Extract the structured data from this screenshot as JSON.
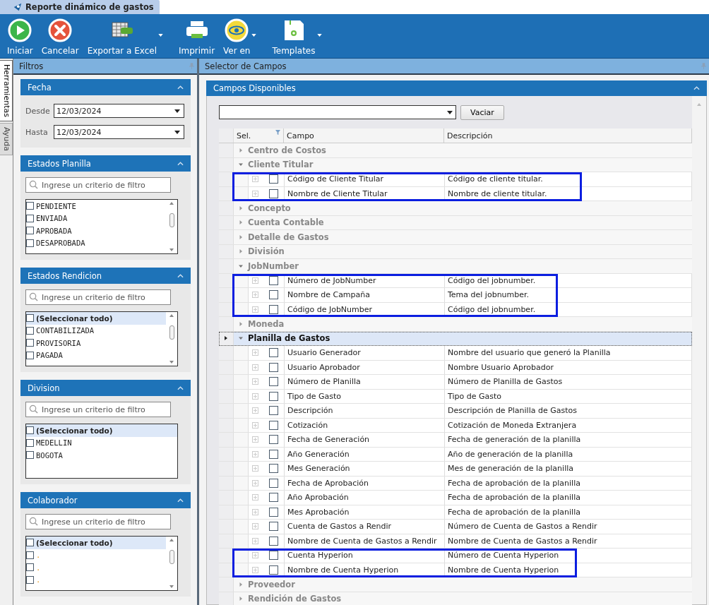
{
  "document_tab": {
    "title": "Reporte dinámico de gastos",
    "selected": true
  },
  "toolbar": [
    {
      "label": "Iniciar",
      "kind": "play",
      "dropdown": false
    },
    {
      "label": "Cancelar",
      "kind": "cancel",
      "dropdown": false
    },
    {
      "label": "Exportar a Excel",
      "kind": "excel",
      "dropdown": true
    },
    {
      "label": "Imprimir",
      "kind": "print",
      "dropdown": false
    },
    {
      "label": "Ver en",
      "kind": "view",
      "dropdown": true
    },
    {
      "label": "Templates",
      "kind": "save",
      "dropdown": true
    }
  ],
  "side_tabs": [
    {
      "label": "Herramientas",
      "selected": true
    },
    {
      "label": "Ayuda",
      "selected": false
    }
  ],
  "filters_panel": {
    "title": "Filtros",
    "sections": [
      {
        "kind": "dates",
        "title": "Fecha",
        "fields": [
          {
            "label": "Desde",
            "value": "12/03/2024"
          },
          {
            "label": "Hasta",
            "value": "12/03/2024"
          }
        ]
      },
      {
        "kind": "list",
        "title": "Estados Planilla",
        "search_placeholder": "Ingrese un criterio de filtro",
        "scrollable": true,
        "items": [
          {
            "label": "PENDIENTE",
            "checked": false,
            "selected": false
          },
          {
            "label": "ENVIADA",
            "checked": false,
            "selected": false
          },
          {
            "label": "APROBADA",
            "checked": false,
            "selected": false
          },
          {
            "label": "DESAPROBADA",
            "checked": false,
            "selected": false
          }
        ]
      },
      {
        "kind": "list",
        "title": "Estados Rendicion",
        "search_placeholder": "Ingrese un criterio de filtro",
        "scrollable": true,
        "items": [
          {
            "label": "(Seleccionar todo)",
            "checked": false,
            "selected": true
          },
          {
            "label": "CONTABILIZADA",
            "checked": false,
            "selected": false
          },
          {
            "label": "PROVISORIA",
            "checked": false,
            "selected": false
          },
          {
            "label": "PAGADA",
            "checked": false,
            "selected": false
          }
        ]
      },
      {
        "kind": "list",
        "title": "Division",
        "search_placeholder": "Ingrese un criterio de filtro",
        "scrollable": false,
        "items": [
          {
            "label": "(Seleccionar todo)",
            "checked": false,
            "selected": true
          },
          {
            "label": "MEDELLIN",
            "checked": false,
            "selected": false
          },
          {
            "label": "BOGOTA",
            "checked": false,
            "selected": false
          }
        ]
      },
      {
        "kind": "list",
        "title": "Colaborador",
        "search_placeholder": "Ingrese un criterio de filtro",
        "scrollable": true,
        "items": [
          {
            "label": "(Seleccionar todo)",
            "checked": false,
            "selected": true
          },
          {
            "label": ".",
            "checked": false,
            "selected": false
          },
          {
            "label": ".",
            "checked": false,
            "selected": false
          },
          {
            "label": ".",
            "checked": false,
            "selected": false
          }
        ]
      }
    ]
  },
  "field_selector": {
    "title": "Selector de Campos",
    "section_title": "Campos Disponibles",
    "clear_button": "Vaciar",
    "columns": [
      "Sel.",
      "Campo",
      "Descripción"
    ],
    "groups": [
      {
        "name": "Centro de Costos",
        "expanded": false,
        "current": false
      },
      {
        "name": "Cliente Titular",
        "expanded": true,
        "current": false,
        "fields": [
          {
            "name": "Código de Cliente Titular",
            "description": "Código de cliente titular.",
            "checked": false,
            "highlighted": true
          },
          {
            "name": "Nombre de Cliente Titular",
            "description": "Nombre de cliente titular.",
            "checked": false,
            "highlighted": true
          }
        ]
      },
      {
        "name": "Concepto",
        "expanded": false,
        "current": false
      },
      {
        "name": "Cuenta Contable",
        "expanded": false,
        "current": false
      },
      {
        "name": "Detalle de Gastos",
        "expanded": false,
        "current": false
      },
      {
        "name": "División",
        "expanded": false,
        "current": false
      },
      {
        "name": "JobNumber",
        "expanded": true,
        "current": false,
        "fields": [
          {
            "name": "Número de JobNumber",
            "description": "Código del jobnumber.",
            "checked": false,
            "highlighted": true
          },
          {
            "name": "Nombre de Campaña",
            "description": "Tema del jobnumber.",
            "checked": false,
            "highlighted": true
          },
          {
            "name": "Código de JobNumber",
            "description": "Código del jobnumber.",
            "checked": false,
            "highlighted": true
          }
        ]
      },
      {
        "name": "Moneda",
        "expanded": false,
        "current": false
      },
      {
        "name": "Planilla de Gastos",
        "expanded": true,
        "current": true,
        "fields": [
          {
            "name": "Usuario Generador",
            "description": "Nombre del usuario que generó la Planilla",
            "checked": false,
            "highlighted": false
          },
          {
            "name": "Usuario Aprobador",
            "description": "Nombre Usuario Aprobador",
            "checked": false,
            "highlighted": false
          },
          {
            "name": "Número de Planilla",
            "description": "Número de Planilla de Gastos",
            "checked": false,
            "highlighted": false
          },
          {
            "name": "Tipo de Gasto",
            "description": "Tipo de Gasto",
            "checked": false,
            "highlighted": false
          },
          {
            "name": "Descripción",
            "description": "Descripción de Planilla de Gastos",
            "checked": false,
            "highlighted": false
          },
          {
            "name": "Cotización",
            "description": "Cotización de Moneda Extranjera",
            "checked": false,
            "highlighted": false
          },
          {
            "name": "Fecha de Generación",
            "description": "Fecha de generación de la planilla",
            "checked": false,
            "highlighted": false
          },
          {
            "name": "Año Generación",
            "description": "Año de generación de la planilla",
            "checked": false,
            "highlighted": false
          },
          {
            "name": "Mes Generación",
            "description": "Mes de generación de la planilla",
            "checked": false,
            "highlighted": false
          },
          {
            "name": "Fecha de Aprobación",
            "description": "Fecha de aprobación de la planilla",
            "checked": false,
            "highlighted": false
          },
          {
            "name": "Año Aprobación",
            "description": "Fecha de aprobación de la planilla",
            "checked": false,
            "highlighted": false
          },
          {
            "name": "Mes Aprobación",
            "description": "Fecha de aprobación de la planilla",
            "checked": false,
            "highlighted": false
          },
          {
            "name": "Cuenta de Gastos a Rendir",
            "description": "Número de Cuenta de Gastos a Rendir",
            "checked": false,
            "highlighted": false
          },
          {
            "name": "Nombre de Cuenta de Gastos a Rendir",
            "description": "Nombre de Cuenta de Gastos a Rendir",
            "checked": false,
            "highlighted": false
          },
          {
            "name": "Cuenta Hyperion",
            "description": "Número de Cuenta Hyperion",
            "checked": false,
            "highlighted": true
          },
          {
            "name": "Nombre de Cuenta Hyperion",
            "description": "Nombre de Cuenta Hyperion",
            "checked": false,
            "highlighted": true
          }
        ]
      },
      {
        "name": "Proveedor",
        "expanded": false,
        "current": false
      },
      {
        "name": "Rendición de Gastos",
        "expanded": false,
        "current": false
      }
    ]
  }
}
